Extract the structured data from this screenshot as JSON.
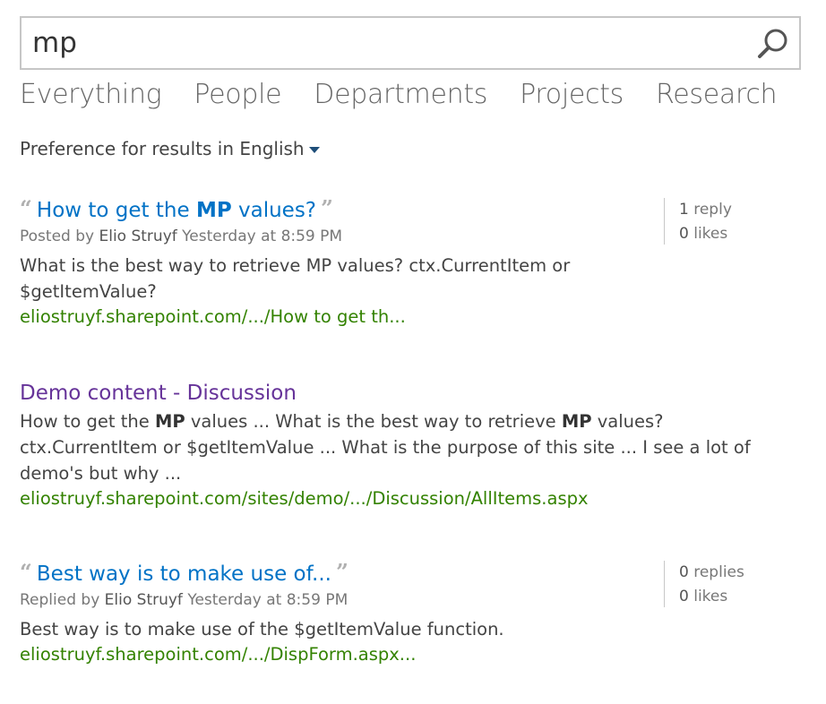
{
  "search": {
    "query": "mp"
  },
  "verticals": [
    "Everything",
    "People",
    "Departments",
    "Projects",
    "Research"
  ],
  "preference": {
    "label": "Preference for results in",
    "language": "English"
  },
  "results": [
    {
      "title_pre": "How to get the ",
      "title_bold": "MP",
      "title_post": " values?",
      "meta_prefix": "Posted by",
      "author": "Elio Struyf",
      "time": "Yesterday at 8:59 PM",
      "summary": "What is the best way to retrieve MP values? ctx.CurrentItem or $getItemValue?",
      "url": "eliostruyf.sharepoint.com/.../How to get th...",
      "replies_count": "1",
      "replies_label": "reply",
      "likes_count": "0",
      "likes_label": "likes"
    },
    {
      "title": "Demo content - Discussion",
      "summary_p1": "How to get the ",
      "summary_b1": "MP",
      "summary_p2": " values ... What is the best way to retrieve ",
      "summary_b2": "MP",
      "summary_p3": " values? ctx.CurrentItem or $getItemValue ... What is the purpose of this site ... I see a lot of demo's but why ...",
      "url": "eliostruyf.sharepoint.com/sites/demo/.../Discussion/AllItems.aspx"
    },
    {
      "title": "Best way is to make use of...",
      "meta_prefix": "Replied by",
      "author": "Elio Struyf",
      "time": "Yesterday at 8:59 PM",
      "summary": "Best way is to make use of the $getItemValue function.",
      "url": "eliostruyf.sharepoint.com/.../DispForm.aspx...",
      "replies_count": "0",
      "replies_label": "replies",
      "likes_count": "0",
      "likes_label": "likes"
    }
  ],
  "colors": {
    "title_link": "#0072c6",
    "visited_link": "#663399",
    "url_green": "#338200",
    "caret": "#1e4e79"
  },
  "icons": {
    "search": "search-icon",
    "dropdown": "caret-down-icon",
    "quote_open": "open-quote-icon",
    "quote_close": "close-quote-icon"
  }
}
